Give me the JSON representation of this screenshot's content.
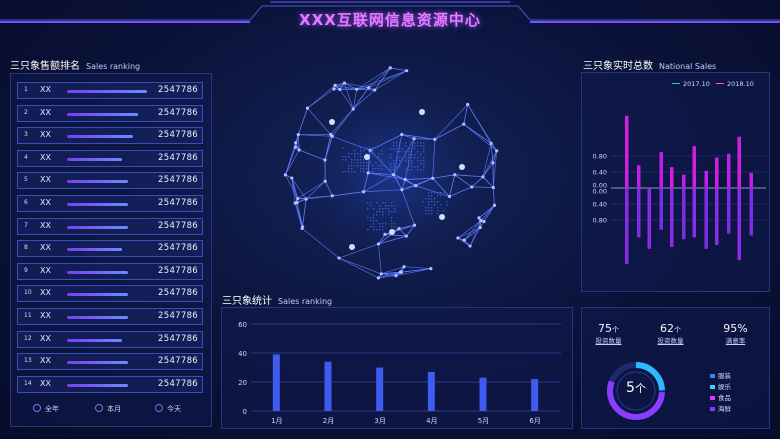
{
  "header": {
    "title": "XXX互联网信息资源中心"
  },
  "ranking": {
    "title": "三只象售额排名",
    "subtitle": "Sales ranking",
    "rows": [
      {
        "no": "1",
        "name": "XX",
        "value": "2547786",
        "fill": 1.0
      },
      {
        "no": "2",
        "name": "XX",
        "value": "2547786",
        "fill": 0.89
      },
      {
        "no": "3",
        "name": "XX",
        "value": "2547786",
        "fill": 0.82
      },
      {
        "no": "4",
        "name": "XX",
        "value": "2547786",
        "fill": 0.69
      },
      {
        "no": "5",
        "name": "XX",
        "value": "2547786",
        "fill": 0.76
      },
      {
        "no": "6",
        "name": "XX",
        "value": "2547786",
        "fill": 0.76
      },
      {
        "no": "7",
        "name": "XX",
        "value": "2547786",
        "fill": 0.76
      },
      {
        "no": "8",
        "name": "XX",
        "value": "2547786",
        "fill": 0.69
      },
      {
        "no": "9",
        "name": "XX",
        "value": "2547786",
        "fill": 0.76
      },
      {
        "no": "10",
        "name": "XX",
        "value": "2547786",
        "fill": 0.76
      },
      {
        "no": "11",
        "name": "XX",
        "value": "2547786",
        "fill": 0.76
      },
      {
        "no": "12",
        "name": "XX",
        "value": "2547786",
        "fill": 0.69
      },
      {
        "no": "13",
        "name": "XX",
        "value": "2547786",
        "fill": 0.76
      },
      {
        "no": "14",
        "name": "XX",
        "value": "2547786",
        "fill": 0.76
      }
    ],
    "filters": [
      "全年",
      "本月",
      "今天"
    ]
  },
  "statistics": {
    "title": "三只象统计",
    "subtitle": "Sales ranking"
  },
  "realtime": {
    "title": "三只象实时总数",
    "subtitle": "National Sales",
    "legend": [
      "2017.10",
      "2018.10"
    ],
    "colors": {
      "s2017": "#c21ee8",
      "s2018": "#8a2be2"
    }
  },
  "stats": {
    "items": [
      {
        "value": "75",
        "unit": "个",
        "label": "投资数量"
      },
      {
        "value": "62",
        "unit": "个",
        "label": "投资数量"
      },
      {
        "value": "95%",
        "unit": "",
        "label": "满意率"
      }
    ],
    "donut": {
      "value": "5",
      "unit": "个"
    },
    "legend": [
      {
        "label": "服装",
        "color": "#2f86ff"
      },
      {
        "label": "娱乐",
        "color": "#2fd6ff"
      },
      {
        "label": "食品",
        "color": "#d03cff"
      },
      {
        "label": "海鲜",
        "color": "#7c3dff"
      }
    ]
  },
  "chart_data": [
    {
      "type": "bar",
      "categories": [
        "1月",
        "2月",
        "3月",
        "4月",
        "5月",
        "6月"
      ],
      "values": [
        39,
        34,
        30,
        27,
        23,
        22
      ],
      "ylim": [
        0,
        60
      ],
      "yticks": [
        "60",
        "40",
        "20",
        "0"
      ],
      "grid": true
    },
    {
      "type": "bar",
      "yticks": [
        "0.80",
        "0.40",
        "0.00",
        "0.00",
        "0.40",
        "0.80"
      ],
      "series": [
        {
          "name": "2017.10",
          "values": [
            1.9,
            -0.2,
            0.55,
            1.1,
            0.8,
            1.35
          ]
        },
        {
          "name": "2018.10",
          "values": [
            -2.0,
            -1.6,
            -1.55,
            -1.3,
            -1.5,
            -1.9
          ]
        }
      ],
      "series_b": [
        {
          "values": [
            0.6,
            0.95,
            0.35,
            0.45,
            0.9,
            0.4
          ]
        },
        {
          "values": [
            -1.3,
            -1.1,
            -1.35,
            -1.6,
            -1.2,
            -1.25
          ]
        }
      ],
      "ylim": [
        -2.2,
        2.2
      ],
      "grid": true
    }
  ]
}
